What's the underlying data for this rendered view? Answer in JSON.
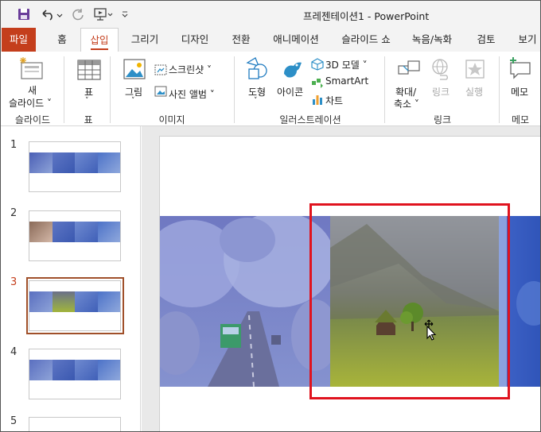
{
  "titlebar": {
    "doc_title": "프레젠테이션1  -  PowerPoint"
  },
  "tabs": [
    "파일",
    "홈",
    "삽입",
    "그리기",
    "디자인",
    "전환",
    "애니메이션",
    "슬라이드 쇼",
    "녹음/녹화",
    "검토",
    "보기"
  ],
  "ribbon": {
    "new_slide": [
      "새",
      "슬라이드 ˅"
    ],
    "table_label": "표",
    "picture_label": "그림",
    "screenshot_label": "스크린샷 ˅",
    "album_label": "사진 앨범 ˅",
    "shapes_label": "도형",
    "icons_label": "아이콘",
    "model3d_label": "3D 모델  ˅",
    "smartart_label": "SmartArt",
    "chart_label": "차트",
    "zoom_label": [
      "확대/",
      "축소 ˅"
    ],
    "link_label": "링크",
    "action_label": "실행",
    "comment_label": "메모",
    "groups": {
      "slides": "슬라이드",
      "table": "표",
      "images": "이미지",
      "illustrations": "일러스트레이션",
      "links": "링크",
      "comments": "메모"
    }
  },
  "slides_panel": {
    "numbers": [
      "1",
      "2",
      "3",
      "4",
      "5"
    ],
    "selected_index": 3
  },
  "colors": {
    "accent": "#c43e1c",
    "selection_box": "#e0131e"
  }
}
